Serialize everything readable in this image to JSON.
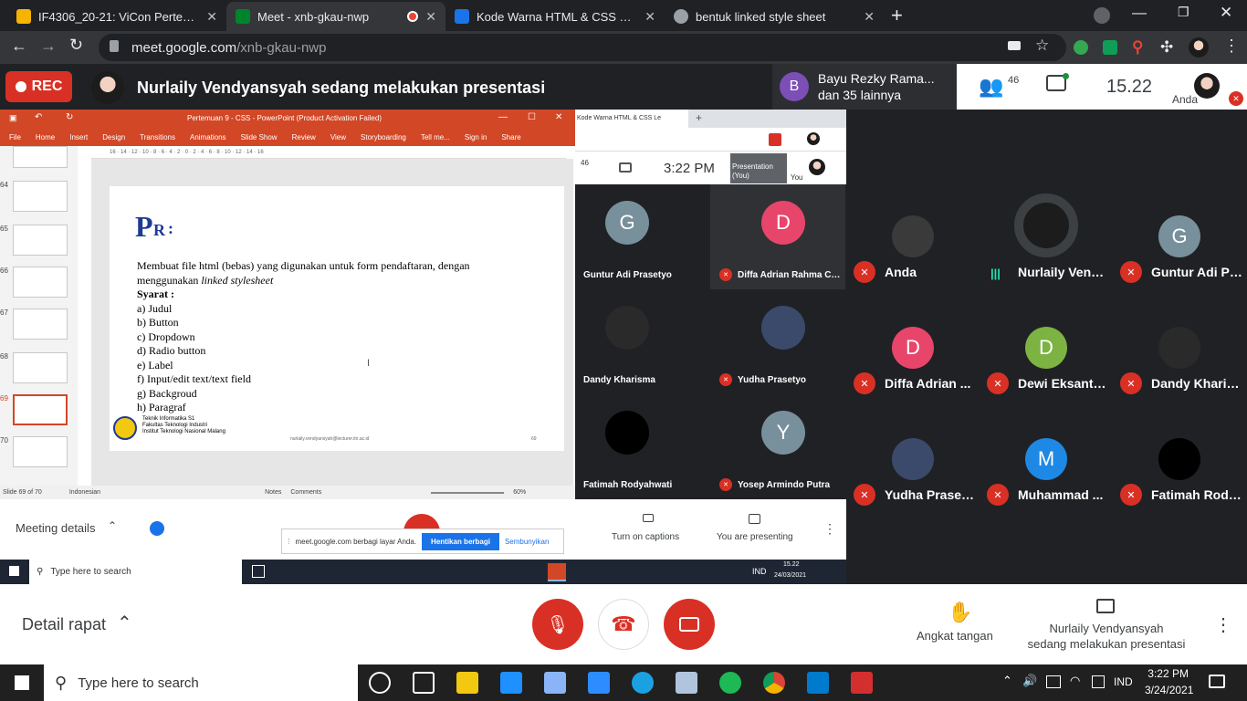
{
  "browser": {
    "tabs": [
      {
        "title": "IF4306_20-21: ViCon Pertemuan 6",
        "fav_color": "#f4b400"
      },
      {
        "title": "Meet - xnb-gkau-nwp",
        "fav_color": "#00832d",
        "recording": true
      },
      {
        "title": "Kode Warna HTML & CSS Lengkap",
        "fav_color": "#1a73e8"
      },
      {
        "title": "bentuk linked style sheet",
        "fav_color": "#9aa0a6"
      }
    ],
    "new_tab": "+",
    "url_host": "meet.google.com",
    "url_path": "/xnb-gkau-nwp"
  },
  "meet_header": {
    "rec_label": "REC",
    "presentation_banner": "Nurlaily Vendyansyah sedang melakukan presentasi",
    "join_initial": "B",
    "join_line1": "Bayu Rezky Rama...",
    "join_line2": "dan 35 lainnya",
    "participants_count": "46",
    "clock": "15.22",
    "self_label": "Anda"
  },
  "powerpoint": {
    "title": "Pertemuan 9 - CSS - PowerPoint (Product Activation Failed)",
    "ribbon_tabs": [
      "File",
      "Home",
      "Insert",
      "Design",
      "Transitions",
      "Animations",
      "Slide Show",
      "Review",
      "View",
      "Storyboarding",
      "Tell me...",
      "Sign in",
      "Share"
    ],
    "thumb_numbers": [
      "64",
      "65",
      "66",
      "67",
      "68",
      "69",
      "70"
    ],
    "ruler": "16 · 14 · 12 · 10 · 8 · 6 · 4 · 2 · 0 · 2 · 4 · 6 · 8 · 10 · 12 · 14 · 16",
    "slide": {
      "logo_big": "P",
      "logo_small": "R",
      "logo_colon": ":",
      "intro_1": "Membuat file html (bebas) yang digunakan untuk form pendaftaran, dengan",
      "intro_2a": "menggunakan ",
      "intro_2b": "linked stylesheet",
      "syarat": "Syarat :",
      "items": [
        "a)   Judul",
        "b)   Button",
        "c)   Dropdown",
        "d)   Radio button",
        "e)   Label",
        "f)    Input/edit text/text field",
        "g)   Backgroud",
        "h)   Paragraf"
      ],
      "footer_1": "Teknik Informatika S1",
      "footer_2": "Fakultas Teknologi Industri",
      "footer_3": "Institut Teknologi Nasional Malang",
      "email": "nurlaily.vendyansyah@lecturer.itn.ac.id",
      "page": "69"
    },
    "status_slide": "Slide 69 of 70",
    "status_lang": "Indonesian",
    "status_notes": "Notes",
    "status_comments": "Comments",
    "status_zoom": "60%"
  },
  "inner_chrome": {
    "tab_title": "Kode Warna HTML & CSS Le",
    "count": "46",
    "time": "3:22 PM",
    "pres_label_1": "Presentation",
    "pres_label_2": "(You)",
    "you_label": "You"
  },
  "inner_tiles": [
    {
      "name": "Guntur Adi Prasetyo",
      "initial": "G",
      "color": "#78909c"
    },
    {
      "name": "Diffa Adrian Rahma Chie...",
      "initial": "D",
      "color": "#e8456b"
    },
    {
      "name": "Dandy Kharisma",
      "initial": "",
      "color": "#2a2a2a"
    },
    {
      "name": "Yudha Prasetyo",
      "initial": "",
      "color": "#3b4a6b"
    },
    {
      "name": "Fatimah Rodyahwati",
      "initial": "",
      "color": "#000000"
    },
    {
      "name": "Yosep Armindo Putra",
      "initial": "Y",
      "color": "#78909c"
    }
  ],
  "inner_bottom": {
    "details": "Meeting details",
    "captions": "Turn on captions",
    "presenting": "You are presenting",
    "share_msg": "meet.google.com berbagi layar Anda.",
    "share_stop": "Hentikan berbagi",
    "share_hide": "Sembunyikan",
    "search": "Type here to search",
    "time": "15.22",
    "date": "24/03/2021",
    "lang": "IND"
  },
  "grid_tiles": [
    {
      "name": "Anda",
      "initial": "",
      "color": "#3a3a3a",
      "muted": true
    },
    {
      "name": "Nurlaily Vend...",
      "initial": "",
      "color": "#1c1c1c",
      "muted": false
    },
    {
      "name": "Guntur Adi Pr...",
      "initial": "G",
      "color": "#78909c",
      "muted": true
    },
    {
      "name": "Diffa Adrian ...",
      "initial": "D",
      "color": "#e8456b",
      "muted": true
    },
    {
      "name": "Dewi Eksanti ...",
      "initial": "D",
      "color": "#7cb342",
      "muted": true
    },
    {
      "name": "Dandy Kharis...",
      "initial": "",
      "color": "#2a2a2a",
      "muted": true
    },
    {
      "name": "Yudha Praset...",
      "initial": "",
      "color": "#3b4a6b",
      "muted": true
    },
    {
      "name": "Muhammad ...",
      "initial": "M",
      "color": "#1e88e5",
      "muted": true
    },
    {
      "name": "Fatimah Rody...",
      "initial": "",
      "color": "#000000",
      "muted": true
    }
  ],
  "meet_bottom": {
    "details": "Detail rapat",
    "raise_hand": "Angkat tangan",
    "presenting_1": "Nurlaily Vendyansyah",
    "presenting_2": "sedang melakukan presentasi"
  },
  "taskbar": {
    "search": "Type here to search",
    "lang": "IND",
    "time": "3:22 PM",
    "date": "3/24/2021",
    "apps": [
      {
        "name": "task-view-icon",
        "color": "#ffffff"
      },
      {
        "name": "camera-icon",
        "color": "#ffffff"
      },
      {
        "name": "file-explorer-icon",
        "color": "#f2c811"
      },
      {
        "name": "phone-app-icon",
        "color": "#1e90ff"
      },
      {
        "name": "notes-app-icon",
        "color": "#8ab4f8"
      },
      {
        "name": "zoom-icon",
        "color": "#2d8cff"
      },
      {
        "name": "edge-icon",
        "color": "#1ba1e2"
      },
      {
        "name": "paint-icon",
        "color": "#b0c4de"
      },
      {
        "name": "spotify-icon",
        "color": "#1db954"
      },
      {
        "name": "chrome-icon",
        "color": "#db4437"
      },
      {
        "name": "vscode-icon",
        "color": "#007acc"
      },
      {
        "name": "acrobat-icon",
        "color": "#d32f2f"
      }
    ]
  }
}
